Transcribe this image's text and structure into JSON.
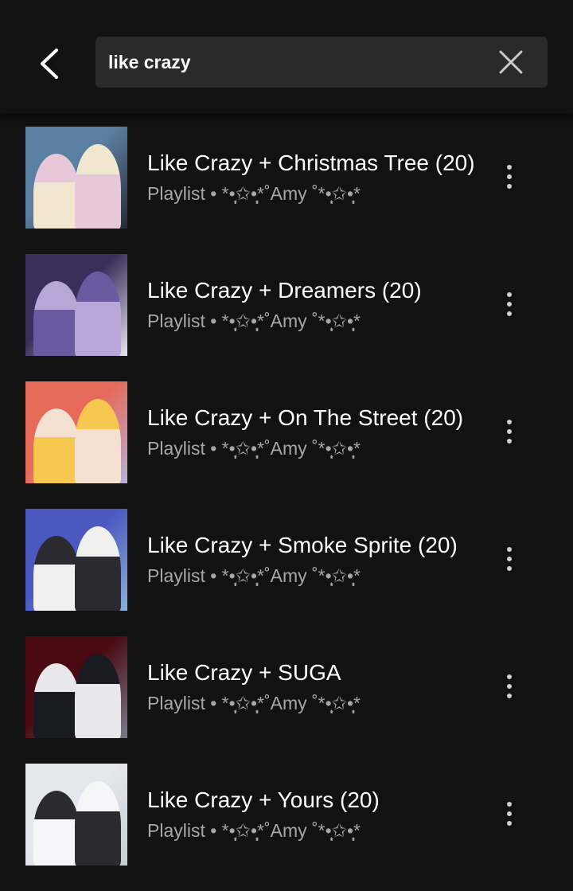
{
  "search": {
    "query": "like crazy"
  },
  "icons": {
    "back": "chevron-left-icon",
    "clear": "close-icon",
    "more": "more-vertical-icon"
  },
  "results": [
    {
      "title": "Like Crazy + Christmas Tree (20)",
      "subtitle": "Playlist • *•̩̩͙✩•̩̩͙*˚Amy ˚*•̩̩͙✩•̩̩͙*",
      "art_colors": [
        "#5a7fa0",
        "#e6c8d8",
        "#2a2a36",
        "#f1e6d0"
      ]
    },
    {
      "title": "Like Crazy + Dreamers (20)",
      "subtitle": "Playlist • *•̩̩͙✩•̩̩͙*˚Amy ˚*•̩̩͙✩•̩̩͙*",
      "art_colors": [
        "#3a2f5a",
        "#b8a6d8",
        "#e8e4ef",
        "#6a5aa0"
      ]
    },
    {
      "title": "Like Crazy + On The Street (20)",
      "subtitle": "Playlist • *•̩̩͙✩•̩̩͙*˚Amy ˚*•̩̩͙✩•̩̩͙*",
      "art_colors": [
        "#e66a5a",
        "#f3e0d0",
        "#b8b0d8",
        "#f7c850"
      ]
    },
    {
      "title": "Like Crazy + Smoke Sprite (20)",
      "subtitle": "Playlist • *•̩̩͙✩•̩̩͙*˚Amy ˚*•̩̩͙✩•̩̩͙*",
      "art_colors": [
        "#4a58c0",
        "#2a2a30",
        "#8ab0d8",
        "#f0f0f0"
      ]
    },
    {
      "title": "Like Crazy + SUGA",
      "subtitle": "Playlist • *•̩̩͙✩•̩̩͙*˚Amy ˚*•̩̩͙✩•̩̩͙*",
      "art_colors": [
        "#4a0a12",
        "#e8e8ec",
        "#7a7a88",
        "#1a1a22"
      ]
    },
    {
      "title": "Like Crazy + Yours (20)",
      "subtitle": "Playlist • *•̩̩͙✩•̩̩͙*˚Amy ˚*•̩̩͙✩•̩̩͙*",
      "art_colors": [
        "#e4e8ee",
        "#2a2a30",
        "#c8ccd4",
        "#f6f6f8"
      ]
    }
  ]
}
